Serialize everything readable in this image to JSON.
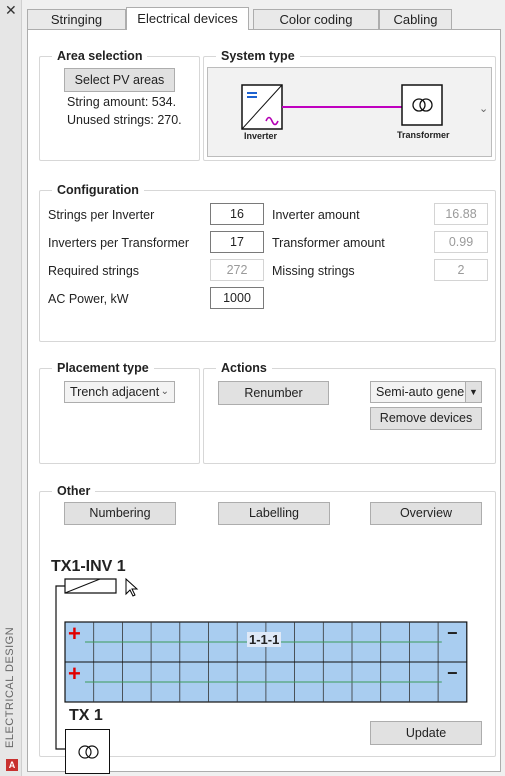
{
  "window": {
    "side_label": "ELECTRICAL DESIGN",
    "close_glyph": "✕"
  },
  "tabs": [
    {
      "label": "Stringing",
      "active": false
    },
    {
      "label": "Electrical devices",
      "active": true
    },
    {
      "label": "Color coding",
      "active": false
    },
    {
      "label": "Cabling",
      "active": false
    }
  ],
  "area_selection": {
    "title": "Area selection",
    "select_button": "Select PV areas",
    "string_amount": "String amount: 534.",
    "unused_strings": "Unused strings: 270."
  },
  "system_type": {
    "title": "System type",
    "inverter_label": "Inverter",
    "transformer_label": "Transformer",
    "dropdown_glyph": "⌄"
  },
  "configuration": {
    "title": "Configuration",
    "strings_per_inverter": {
      "label": "Strings per Inverter",
      "value": "16"
    },
    "inverters_per_transformer": {
      "label": "Inverters per Transformer",
      "value": "17"
    },
    "required_strings": {
      "label": "Required strings",
      "value": "272"
    },
    "ac_power": {
      "label": "AC Power, kW",
      "value": "1000"
    },
    "inverter_amount": {
      "label": "Inverter amount",
      "value": "16.88"
    },
    "transformer_amount": {
      "label": "Transformer amount",
      "value": "0.99"
    },
    "missing_strings": {
      "label": "Missing strings",
      "value": "2"
    }
  },
  "placement": {
    "title": "Placement type",
    "selected": "Trench adjacent"
  },
  "actions": {
    "title": "Actions",
    "renumber": "Renumber",
    "mode_selected": "Semi-auto gener",
    "remove_devices": "Remove devices"
  },
  "other": {
    "title": "Other",
    "numbering": "Numbering",
    "labelling": "Labelling",
    "overview": "Overview",
    "update": "Update"
  },
  "preview": {
    "inverter_name": "TX1-INV 1",
    "transformer_name": "TX 1",
    "string_label": "1-1-1",
    "plus_glyph": "+",
    "minus_glyph": "−"
  }
}
